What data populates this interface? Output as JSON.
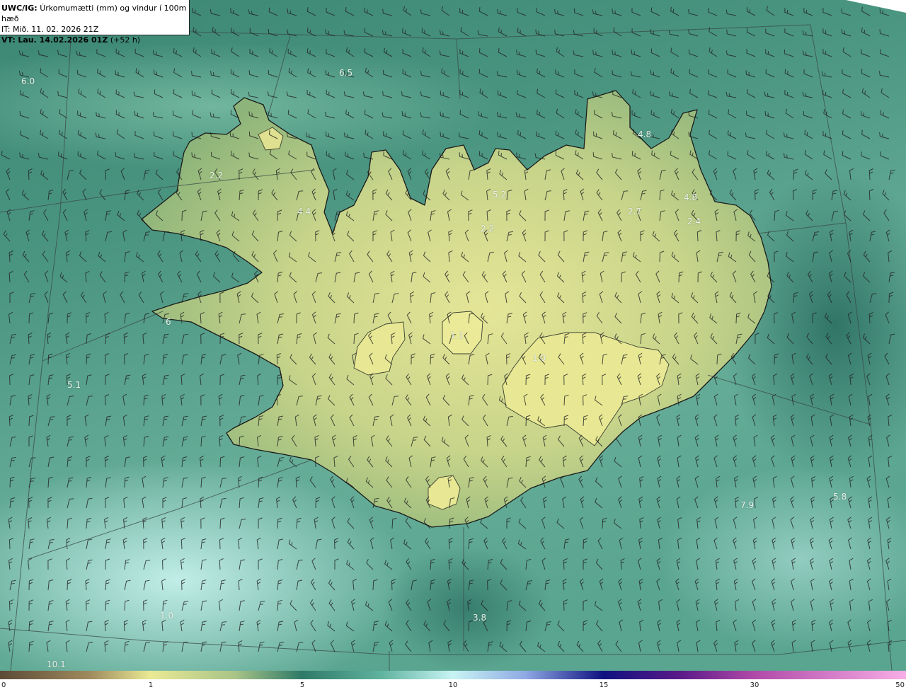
{
  "header": {
    "product": "UWC/IG:",
    "title": "Úrkomumætti (mm) og vindur í 100m hæð",
    "initial_time_label": "IT:",
    "initial_time": "Mið. 11. 02. 2026 21Z",
    "valid_time_label": "VT:",
    "valid_time": "Lau. 14.02.2026 01Z",
    "lead_time": "(+52 h)"
  },
  "map_labels": [
    "6.0",
    "6.5",
    "2.2",
    "4.4",
    "4.8",
    "5.2",
    "2.7",
    "4.8",
    "2.4",
    "2.2",
    "1.1",
    "1.0",
    "6",
    "5.1",
    "5.8",
    "7.9",
    "3.8",
    "1.0",
    "10.1"
  ],
  "colorbar": {
    "ticks": [
      "0",
      "1",
      "5",
      "10",
      "15",
      "30",
      "50"
    ],
    "colors": {
      "low": "#5c4a36",
      "tan": "#b9a56b",
      "yellow": "#eaea95",
      "green": "#2e7a68",
      "cyan": "#c8f4f4",
      "blue": "#0f1180",
      "purple": "#8a2d9a",
      "pink": "#f7aee6"
    }
  },
  "colors": {
    "sea_dark": "#2f7769",
    "sea_mid": "#4f9d88",
    "land_low": "#9fbf82",
    "land_high": "#e6e79a",
    "sea_light": "#b8ece6",
    "coast": "#1a1a1a",
    "grid": "#3a4a44",
    "barb": "#222222"
  }
}
